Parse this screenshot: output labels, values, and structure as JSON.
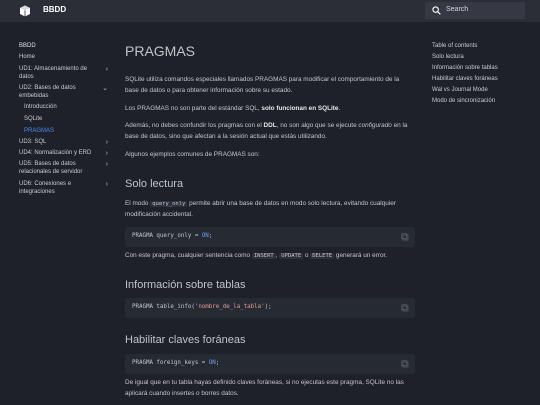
{
  "header": {
    "site_title": "BBDD",
    "search_placeholder": "Search",
    "logo_icon": "logo-icon",
    "search_icon": "search-icon"
  },
  "nav": {
    "header": "BBDD",
    "items": [
      {
        "label": "Home",
        "chevron": ""
      },
      {
        "label": "UD1: Almacenamiento de datos",
        "chevron": "›"
      },
      {
        "label": "UD2: Bases de datos embebidas",
        "chevron": "⌄"
      },
      {
        "label": "Introducción",
        "chevron": ""
      },
      {
        "label": "SQLite",
        "chevron": ""
      },
      {
        "label": "PRAGMAS",
        "chevron": ""
      },
      {
        "label": "UD3: SQL",
        "chevron": "›"
      },
      {
        "label": "UD4: Normalización y ERD",
        "chevron": "›"
      },
      {
        "label": "UD5: Bases de datos relacionales de servidor",
        "chevron": "›"
      },
      {
        "label": "UD6: Conexiones e integraciones",
        "chevron": "›"
      }
    ]
  },
  "toc": {
    "items": [
      "Table of contents",
      "Solo lectura",
      "Información sobre tablas",
      "Habilitar claves foráneas",
      "Wal vs Journal Mode",
      "Modo de sincronización"
    ]
  },
  "main": {
    "title": "PRAGMAS",
    "intro_1": "SQLite utiliza comandos especiales llamados PRAGMAS para modificar el comportamiento de la base de datos o para obtener información sobre su estado.",
    "intro_2_pre": "Los PRAGMAS no son parte del estándar SQL, ",
    "intro_2_bold": "solo funcionan en SQLite",
    "intro_2_post": ".",
    "intro_3_pre": "Además, no debes confundir los pragmas con el ",
    "intro_3_bold": "DDL",
    "intro_3_mid": ", no son algo que se ejecute ",
    "intro_3_em": "configurado",
    "intro_3_post": " en la base de datos, sino que afectan a la sesión actual que estás utilizando.",
    "intro_4": "Algunos ejemplos comunes de PRAGMAS son:",
    "sec1_title": "Solo lectura",
    "sec1_p1_pre": "El modo ",
    "sec1_p1_code": "query_only",
    "sec1_p1_post": " permite abrir una base de datos en modo solo lectura, evitando cualquier modificación accidental.",
    "sec1_code_pre": "PRAGMA query_only = ",
    "sec1_code_val": "ON",
    "sec1_code_post": ";",
    "sec1_p2_pre": "Con este pragma, cualquier sentencia como ",
    "sec1_p2_c1": "INSERT",
    "sec1_p2_c2": "UPDATE",
    "sec1_p2_c3": "DELETE",
    "sec1_p2_post": " generará un error.",
    "sec1_p2_sep1": ", ",
    "sec1_p2_sep2": " o ",
    "sec2_title": "Información sobre tablas",
    "sec2_code_pre": "PRAGMA table_info(",
    "sec2_code_val": "'nombre_de_la_tabla'",
    "sec2_code_post": ");",
    "sec3_title": "Habilitar claves foráneas",
    "sec3_code_pre": "PRAGMA foreign_keys = ",
    "sec3_code_val": "ON",
    "sec3_code_post": ";",
    "sec3_p1": "De igual que en tu tabla hayas definido claves foráneas, si no ejecutas este pragma, SQLite no las aplicará cuando insertes o borres datos.",
    "copy_icon": "copy-icon"
  }
}
